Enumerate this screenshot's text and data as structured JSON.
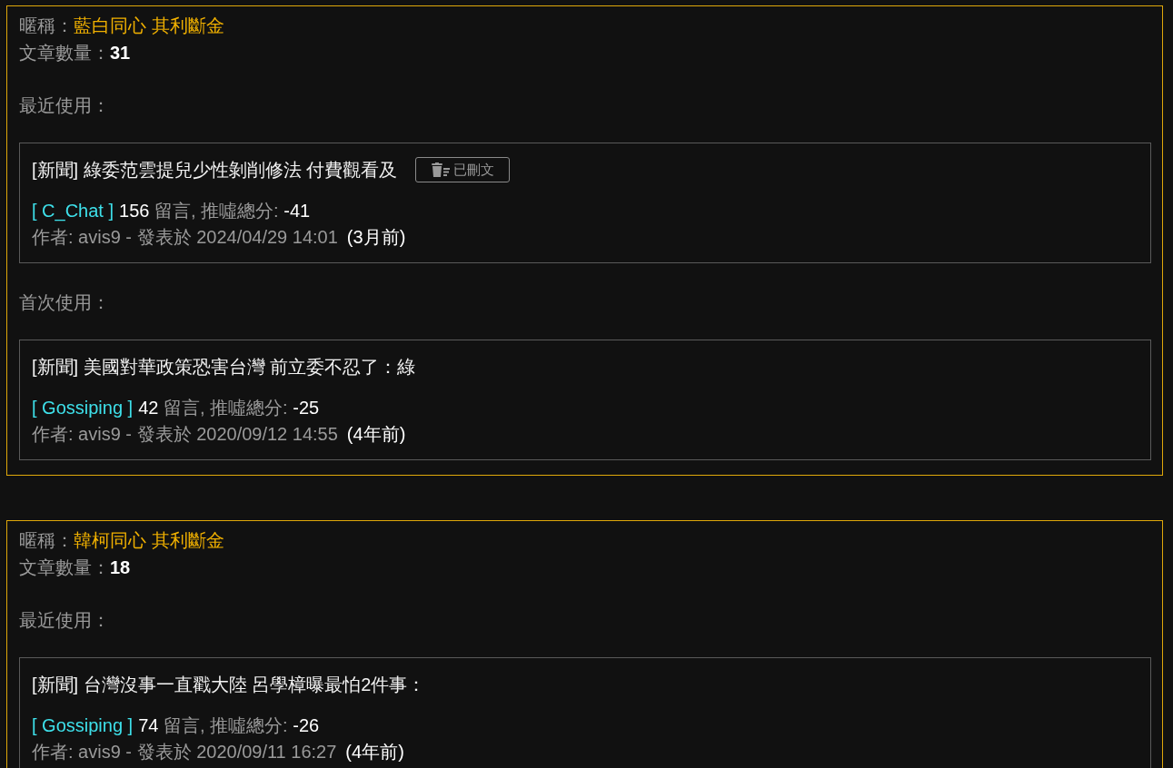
{
  "users": [
    {
      "nickname_label": "暱稱：",
      "nickname": "藍白同心 其利斷金",
      "count_label": "文章數量：",
      "count": "31",
      "sections": [
        {
          "heading": "最近使用：",
          "post": {
            "title": "[新聞] 綠委范雲提兒少性剝削修法 付費觀看及",
            "deleted": true,
            "deleted_label": "已刪文",
            "board": "[ C_Chat ]",
            "comments": "156",
            "comments_label": "留言, 推噓總分:",
            "score": "-41",
            "byline": "作者: avis9 - 發表於 2024/04/29 14:01",
            "age": "(3月前)"
          }
        },
        {
          "heading": "首次使用：",
          "post": {
            "title": "[新聞] 美國對華政策恐害台灣 前立委不忍了：綠",
            "deleted": false,
            "board": "[ Gossiping ]",
            "comments": "42",
            "comments_label": "留言, 推噓總分:",
            "score": "-25",
            "byline": "作者: avis9 - 發表於 2020/09/12 14:55",
            "age": "(4年前)"
          }
        }
      ]
    },
    {
      "nickname_label": "暱稱：",
      "nickname": "韓柯同心 其利斷金",
      "count_label": "文章數量：",
      "count": "18",
      "sections": [
        {
          "heading": "最近使用：",
          "post": {
            "title": "[新聞] 台灣沒事一直戳大陸 呂學樟曝最怕2件事：",
            "deleted": false,
            "board": "[ Gossiping ]",
            "comments": "74",
            "comments_label": "留言, 推噓總分:",
            "score": "-26",
            "byline": "作者: avis9 - 發表於 2020/09/11 16:27",
            "age": "(4年前)"
          }
        }
      ]
    }
  ]
}
